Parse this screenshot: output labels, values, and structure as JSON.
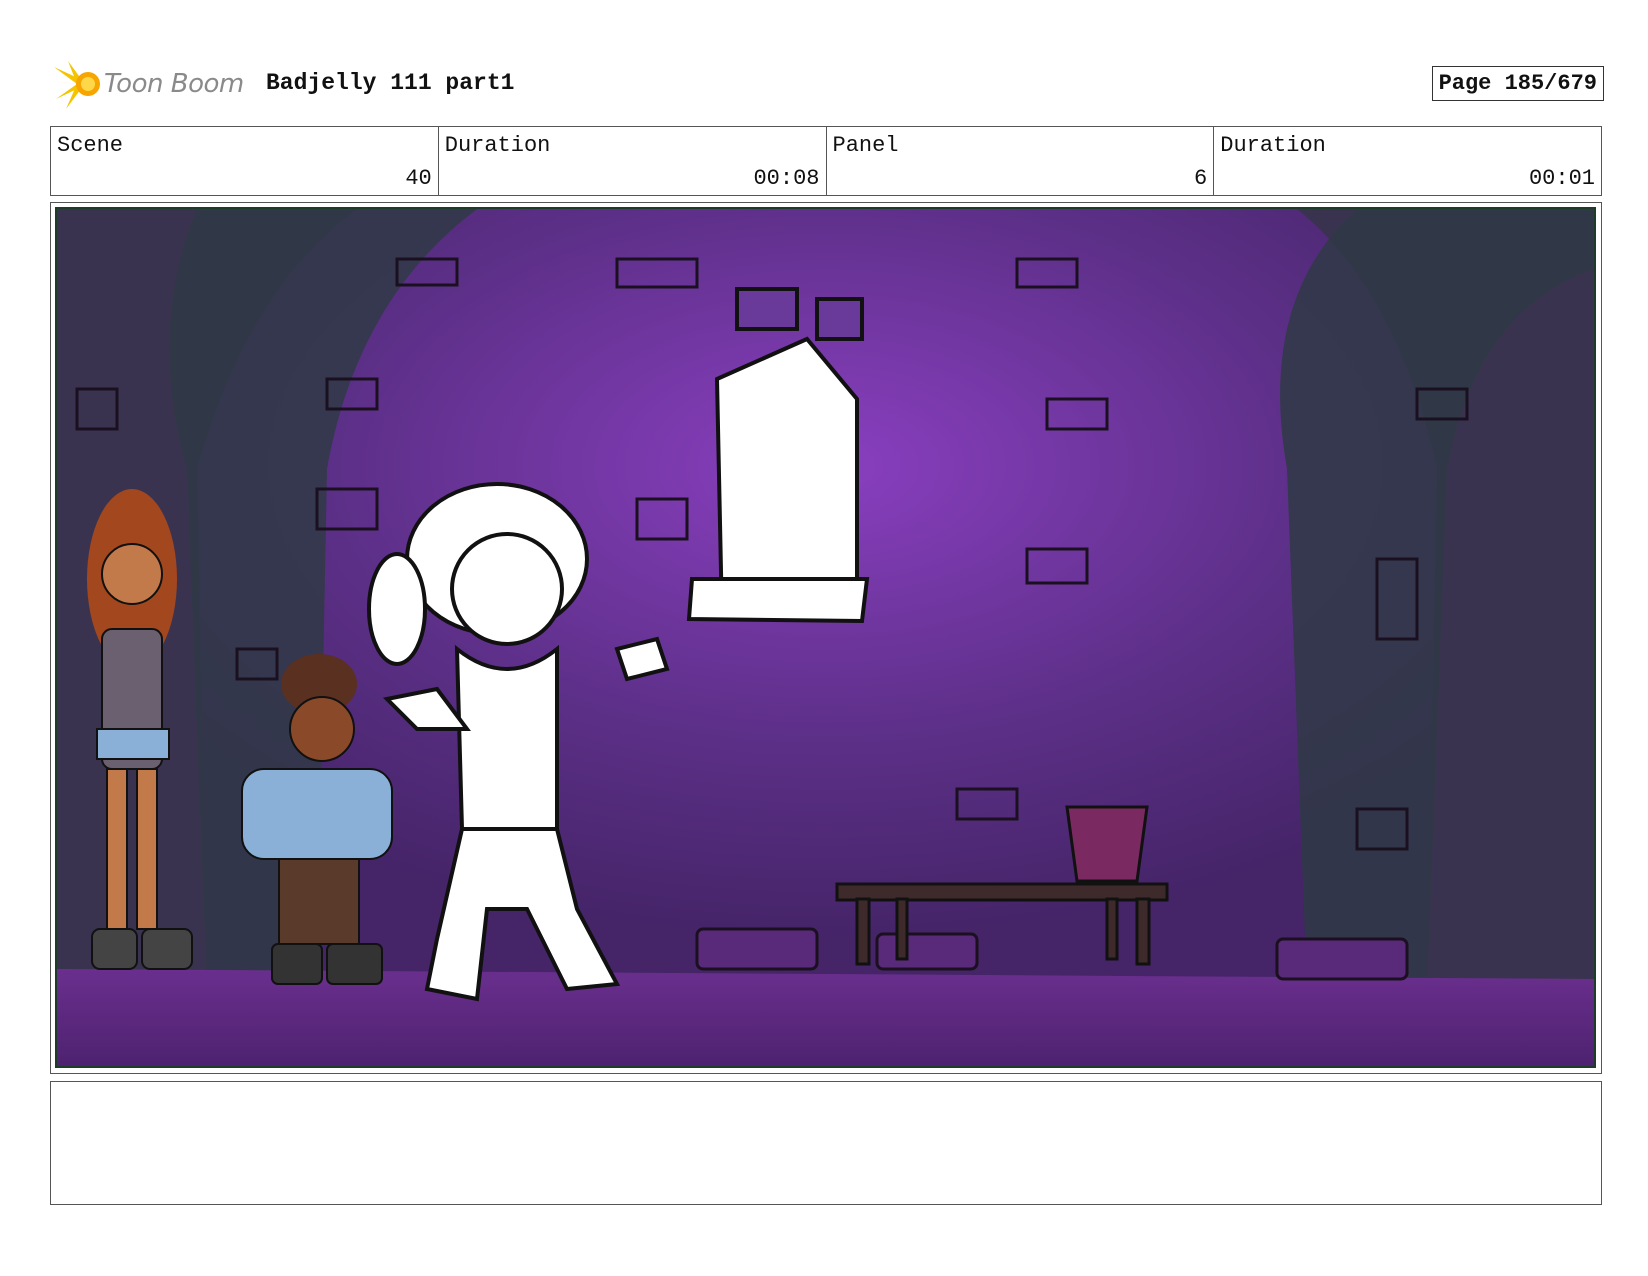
{
  "header": {
    "logo_text": "Toon Boom",
    "project_title": "Badjelly 111 part1",
    "page_label": "Page 185/679"
  },
  "info": {
    "scene_label": "Scene",
    "scene_value": "40",
    "scene_duration_label": "Duration",
    "scene_duration_value": "00:08",
    "panel_label": "Panel",
    "panel_value": "6",
    "panel_duration_label": "Duration",
    "panel_duration_value": "00:01"
  },
  "colors": {
    "wall_purple": "#5b2f86",
    "wall_glow": "#8a3fc0",
    "pillar_dark": "#2f3a45",
    "floor_purple": "#6a2f8e",
    "logo_yellow": "#f5c400"
  }
}
